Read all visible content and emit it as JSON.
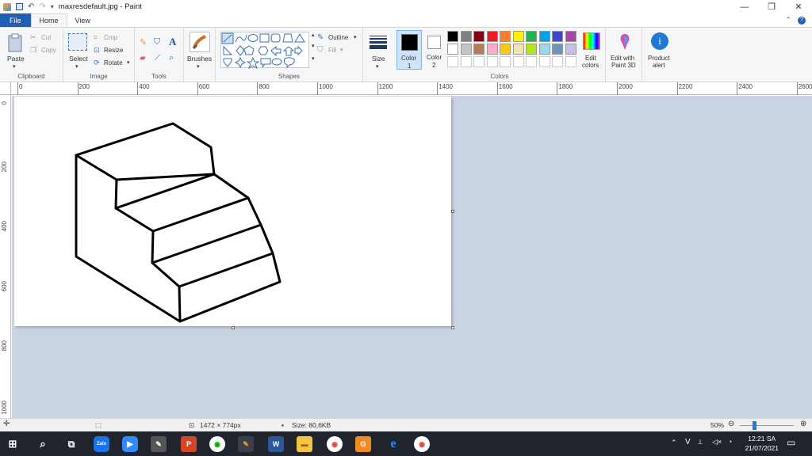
{
  "window": {
    "title": "maxresdefault.jpg - Paint",
    "controls": {
      "minimize": "—",
      "maximize": "❐",
      "close": "✕"
    }
  },
  "tabs": {
    "file": "File",
    "home": "Home",
    "view": "View"
  },
  "ribbon": {
    "clipboard": {
      "label": "Clipboard",
      "paste": "Paste",
      "cut": "Cut",
      "copy": "Copy"
    },
    "image": {
      "label": "Image",
      "select": "Select",
      "crop": "Crop",
      "resize": "Resize",
      "rotate": "Rotate"
    },
    "tools": {
      "label": "Tools"
    },
    "brushes": {
      "label": "Brushes"
    },
    "shapes": {
      "label": "Shapes",
      "outline": "Outline",
      "fill": "Fill"
    },
    "size": {
      "label": "Size"
    },
    "colors": {
      "label": "Colors",
      "color1": "Color\n1",
      "color1_a": "Color",
      "color1_b": "1",
      "color2_a": "Color",
      "color2_b": "2",
      "edit_colors_a": "Edit",
      "edit_colors_b": "colors",
      "palette_row1": [
        "#000000",
        "#7f7f7f",
        "#880015",
        "#ed1c24",
        "#ff7f27",
        "#fff200",
        "#22b14c",
        "#00a2e8",
        "#3f48cc",
        "#a349a4"
      ],
      "palette_row2": [
        "#ffffff",
        "#c3c3c3",
        "#b97a57",
        "#ffaec9",
        "#ffc90e",
        "#efe4b0",
        "#b5e61d",
        "#99d9ea",
        "#7092be",
        "#c8bfe7"
      ],
      "color1_value": "#000000",
      "color2_value": "#ffffff"
    },
    "paint3d": {
      "a": "Edit with",
      "b": "Paint 3D"
    },
    "product_alert": {
      "a": "Product",
      "b": "alert"
    }
  },
  "ruler": {
    "h_ticks": [
      "0",
      "200",
      "400",
      "600",
      "800",
      "1000",
      "1200",
      "1400",
      "1600",
      "1800",
      "2000",
      "2200",
      "2400",
      "2600"
    ],
    "v_ticks": [
      "0",
      "200",
      "400",
      "600",
      "800",
      "1000"
    ]
  },
  "status": {
    "dimensions": "1472 × 774px",
    "size": "Size: 80,6KB",
    "zoom": "50%"
  },
  "taskbar": {
    "time": "12:21 SA",
    "date": "21/07/2021",
    "tray_letter": "V"
  }
}
